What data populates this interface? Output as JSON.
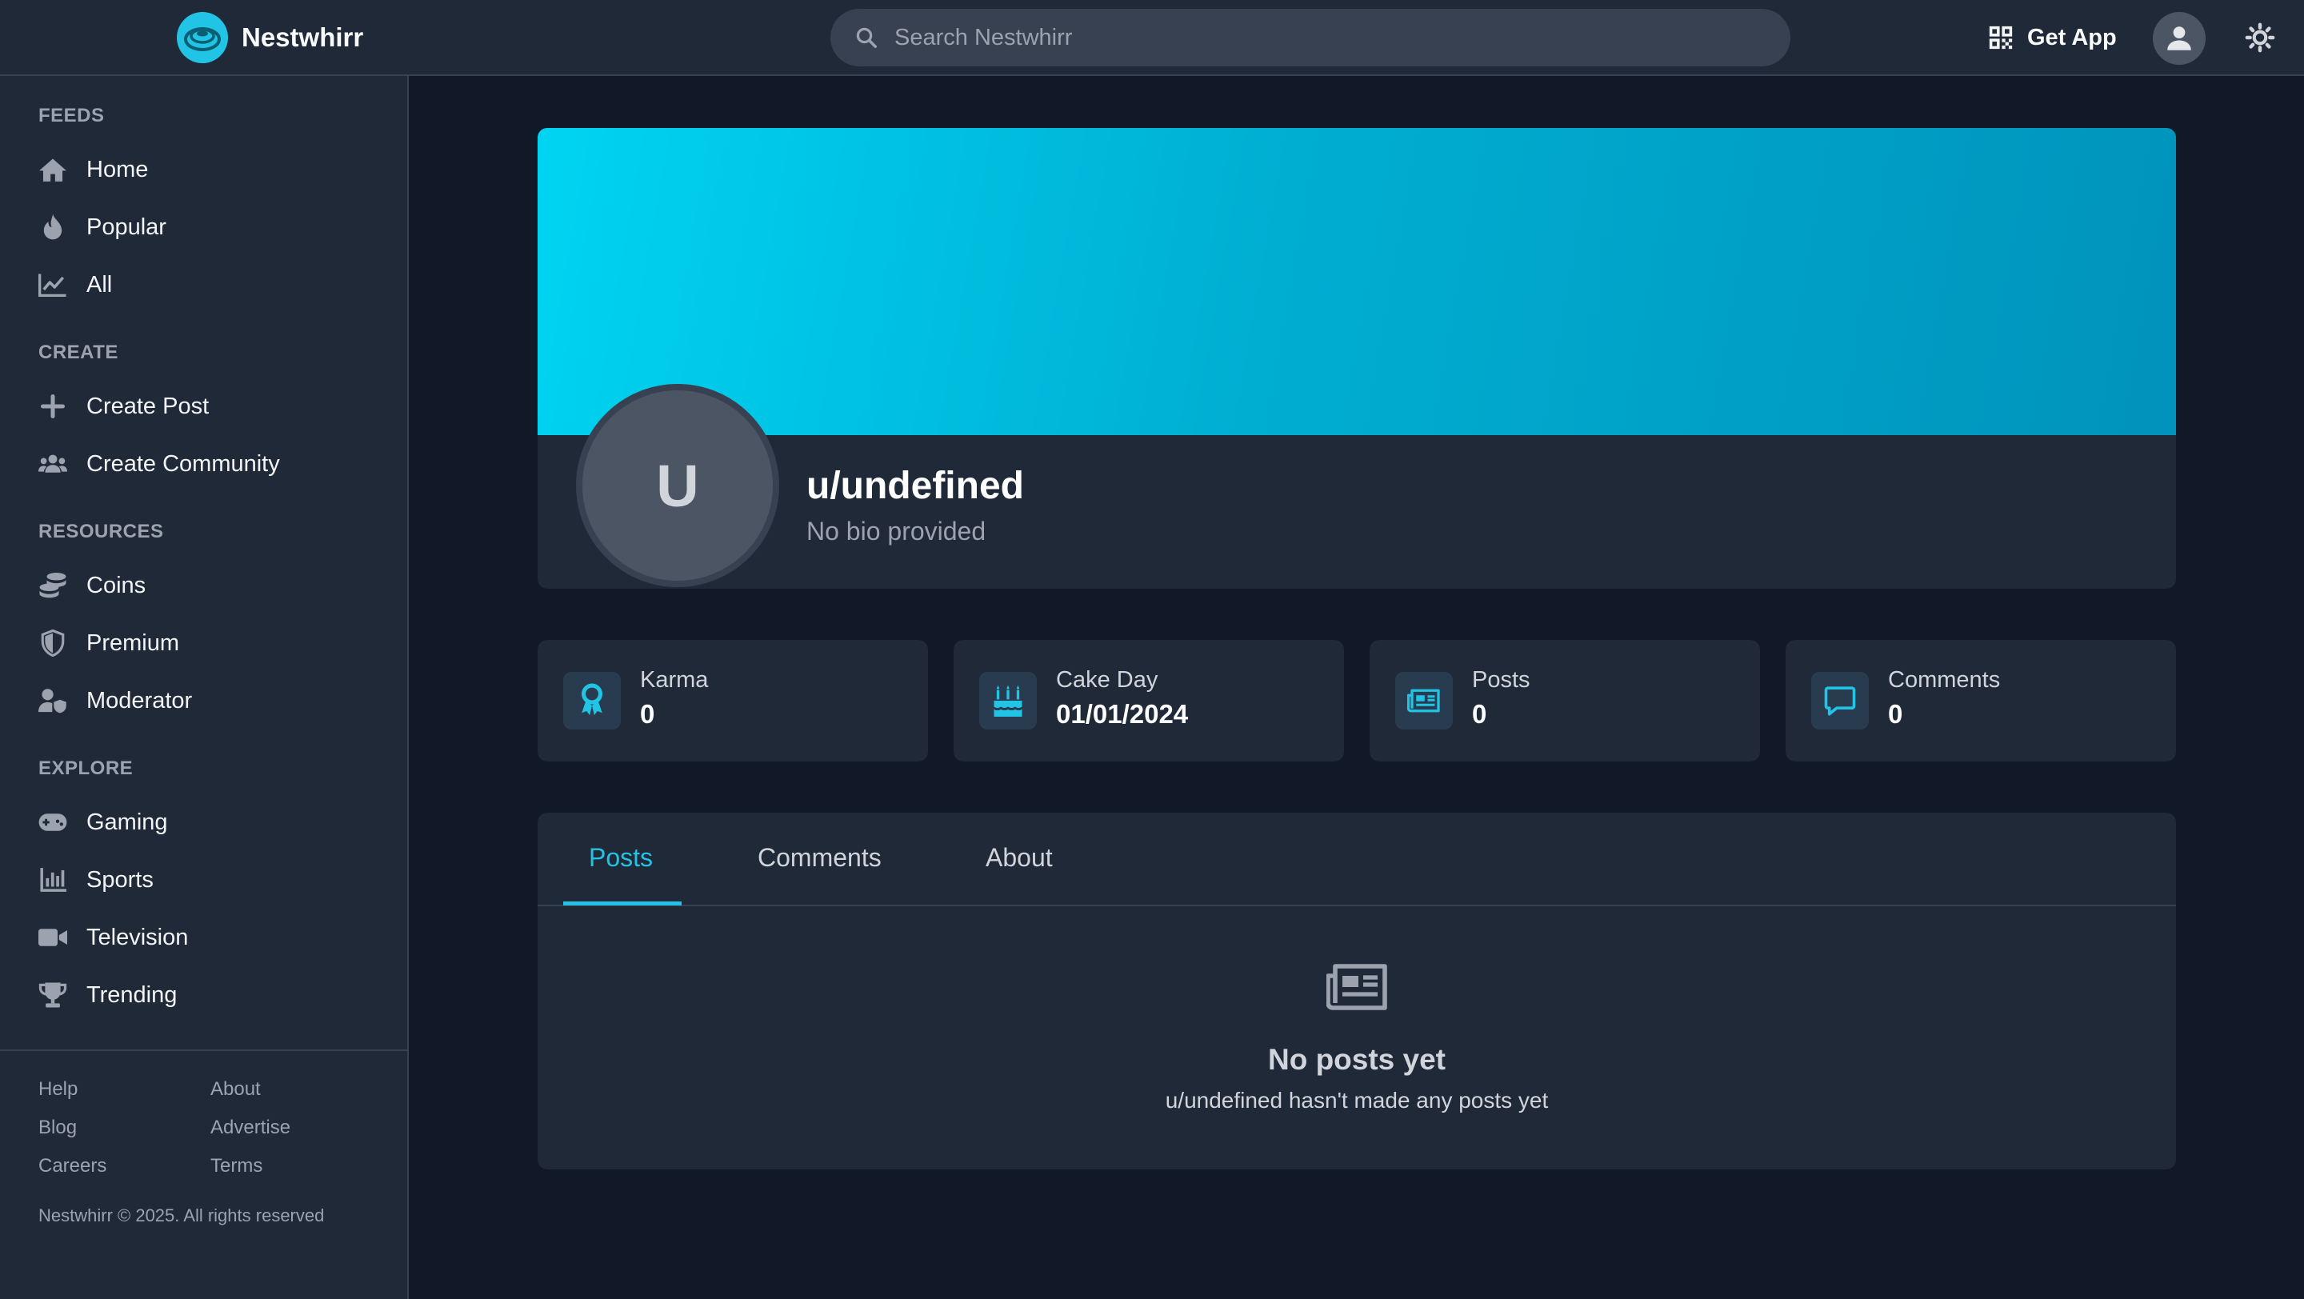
{
  "header": {
    "brand": "Nestwhirr",
    "search_placeholder": "Search Nestwhirr",
    "get_app_label": "Get App"
  },
  "sidebar": {
    "sections": [
      {
        "title": "FEEDS",
        "items": [
          {
            "label": "Home",
            "icon": "home-icon"
          },
          {
            "label": "Popular",
            "icon": "fire-icon"
          },
          {
            "label": "All",
            "icon": "chart-line-icon"
          }
        ]
      },
      {
        "title": "CREATE",
        "items": [
          {
            "label": "Create Post",
            "icon": "plus-icon"
          },
          {
            "label": "Create Community",
            "icon": "users-icon"
          }
        ]
      },
      {
        "title": "RESOURCES",
        "items": [
          {
            "label": "Coins",
            "icon": "coins-icon"
          },
          {
            "label": "Premium",
            "icon": "shield-icon"
          },
          {
            "label": "Moderator",
            "icon": "user-shield-icon"
          }
        ]
      },
      {
        "title": "EXPLORE",
        "items": [
          {
            "label": "Gaming",
            "icon": "gamepad-icon"
          },
          {
            "label": "Sports",
            "icon": "bar-chart-icon"
          },
          {
            "label": "Television",
            "icon": "video-icon"
          },
          {
            "label": "Trending",
            "icon": "trophy-icon"
          }
        ]
      }
    ],
    "footer_links": [
      "Help",
      "About",
      "Blog",
      "Advertise",
      "Careers",
      "Terms"
    ],
    "copyright": "Nestwhirr © 2025. All rights reserved"
  },
  "profile": {
    "avatar_letter": "U",
    "username": "u/undefined",
    "bio": "No bio provided"
  },
  "stats": [
    {
      "label": "Karma",
      "value": "0",
      "icon": "award-icon"
    },
    {
      "label": "Cake Day",
      "value": "01/01/2024",
      "icon": "cake-icon"
    },
    {
      "label": "Posts",
      "value": "0",
      "icon": "newspaper-icon"
    },
    {
      "label": "Comments",
      "value": "0",
      "icon": "comment-icon"
    }
  ],
  "tabs": [
    "Posts",
    "Comments",
    "About"
  ],
  "active_tab": "Posts",
  "empty_state": {
    "title": "No posts yet",
    "subtitle": "u/undefined hasn't made any posts yet"
  },
  "colors": {
    "accent": "#22c4e6",
    "background": "#111827",
    "surface": "#1f2937",
    "banner_start": "#00d4f2",
    "banner_end": "#0093bb"
  }
}
